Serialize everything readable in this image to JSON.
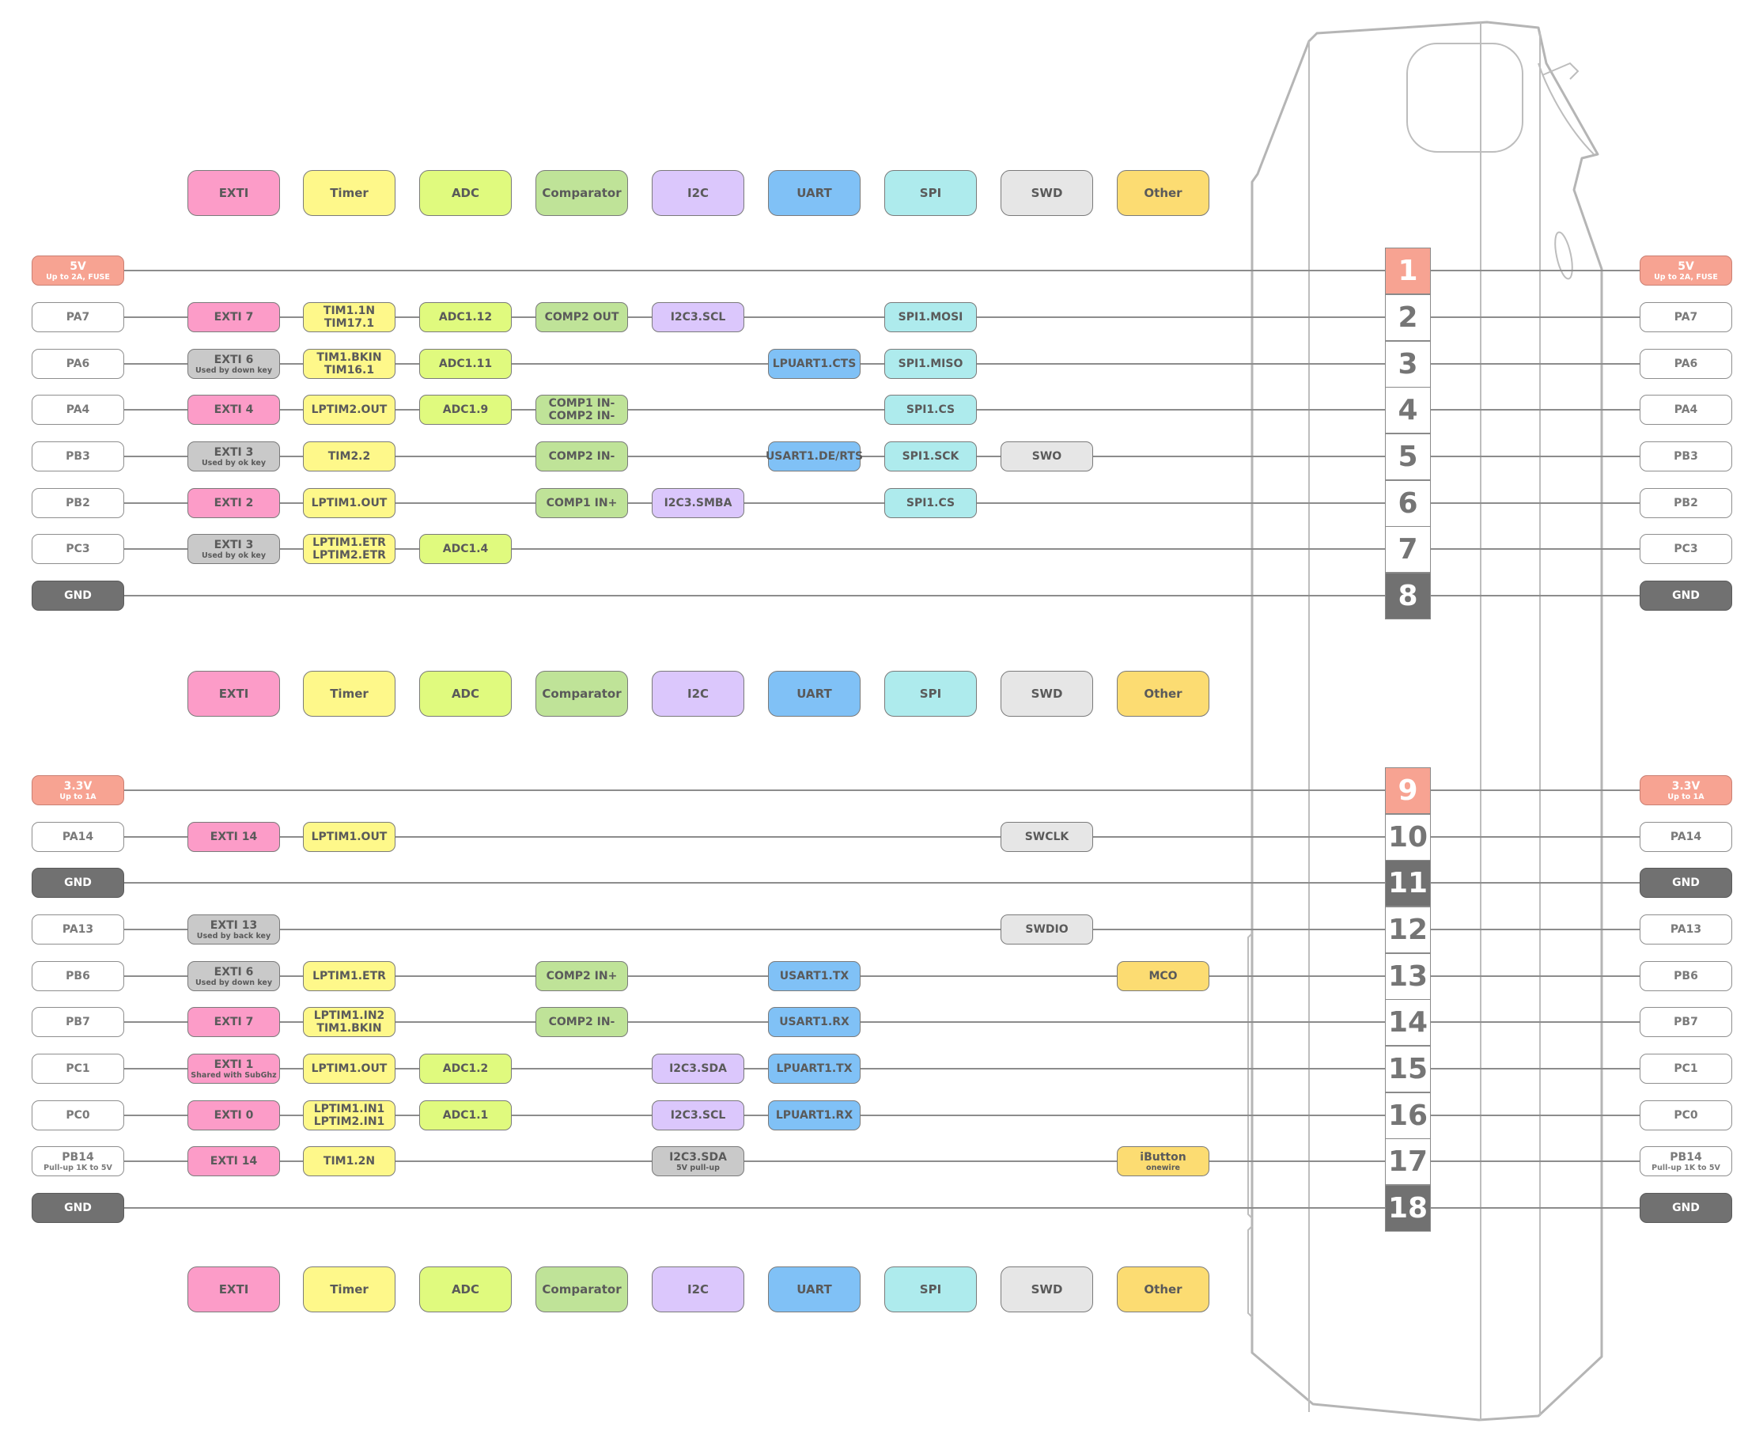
{
  "legend": [
    {
      "key": "exti",
      "label": "EXTI",
      "color": "#fc9cc8"
    },
    {
      "key": "timer",
      "label": "Timer",
      "color": "#fef88a"
    },
    {
      "key": "adc",
      "label": "ADC",
      "color": "#e0fa7e"
    },
    {
      "key": "comp",
      "label": "Comparator",
      "color": "#bfe398"
    },
    {
      "key": "i2c",
      "label": "I2C",
      "color": "#dbc7fc"
    },
    {
      "key": "uart",
      "label": "UART",
      "color": "#80c1f6"
    },
    {
      "key": "spi",
      "label": "SPI",
      "color": "#aeebed"
    },
    {
      "key": "swd",
      "label": "SWD",
      "color": "#e6e6e6"
    },
    {
      "key": "other",
      "label": "Other",
      "color": "#fcdc72"
    }
  ],
  "status_colors": {
    "power": "#f7a392",
    "ground": "#717171",
    "used_by_system": "#c9c9c9",
    "pin": "#ffffff"
  },
  "pins": [
    {
      "number": "1",
      "type": "power",
      "name": "5V",
      "note": "Up to 2A, FUSE",
      "functions": {}
    },
    {
      "number": "2",
      "type": "pin",
      "name": "PA7",
      "note": "",
      "functions": {
        "exti": {
          "label": "EXTI 7"
        },
        "timer": {
          "label": "TIM1.1N",
          "label2": "TIM17.1"
        },
        "adc": {
          "label": "ADC1.12"
        },
        "comp": {
          "label": "COMP2 OUT"
        },
        "i2c": {
          "label": "I2C3.SCL"
        },
        "spi": {
          "label": "SPI1.MOSI"
        }
      }
    },
    {
      "number": "3",
      "type": "pin",
      "name": "PA6",
      "note": "",
      "functions": {
        "exti": {
          "label": "EXTI 6",
          "note": "Used by down key",
          "used": true
        },
        "timer": {
          "label": "TIM1.BKIN",
          "label2": "TIM16.1"
        },
        "adc": {
          "label": "ADC1.11"
        },
        "uart": {
          "label": "LPUART1.CTS"
        },
        "spi": {
          "label": "SPI1.MISO"
        }
      }
    },
    {
      "number": "4",
      "type": "pin",
      "name": "PA4",
      "note": "",
      "functions": {
        "exti": {
          "label": "EXTI 4"
        },
        "timer": {
          "label": "LPTIM2.OUT"
        },
        "adc": {
          "label": "ADC1.9"
        },
        "comp": {
          "label": "COMP1 IN-",
          "label2": "COMP2 IN-"
        },
        "spi": {
          "label": "SPI1.CS"
        }
      }
    },
    {
      "number": "5",
      "type": "pin",
      "name": "PB3",
      "note": "",
      "functions": {
        "exti": {
          "label": "EXTI 3",
          "note": "Used by ok key",
          "used": true
        },
        "timer": {
          "label": "TIM2.2"
        },
        "comp": {
          "label": "COMP2 IN-"
        },
        "uart": {
          "label": "USART1.DE/RTS"
        },
        "spi": {
          "label": "SPI1.SCK"
        },
        "swd": {
          "label": "SWO"
        }
      }
    },
    {
      "number": "6",
      "type": "pin",
      "name": "PB2",
      "note": "",
      "functions": {
        "exti": {
          "label": "EXTI 2"
        },
        "timer": {
          "label": "LPTIM1.OUT"
        },
        "comp": {
          "label": "COMP1 IN+"
        },
        "i2c": {
          "label": "I2C3.SMBA"
        },
        "spi": {
          "label": "SPI1.CS"
        }
      }
    },
    {
      "number": "7",
      "type": "pin",
      "name": "PC3",
      "note": "",
      "functions": {
        "exti": {
          "label": "EXTI 3",
          "note": "Used by ok key",
          "used": true
        },
        "timer": {
          "label": "LPTIM1.ETR",
          "label2": "LPTIM2.ETR"
        },
        "adc": {
          "label": "ADC1.4"
        }
      }
    },
    {
      "number": "8",
      "type": "gnd",
      "name": "GND",
      "note": "",
      "functions": {}
    },
    {
      "number": "9",
      "type": "power",
      "name": "3.3V",
      "note": "Up to 1A",
      "functions": {}
    },
    {
      "number": "10",
      "type": "pin",
      "name": "PA14",
      "note": "",
      "functions": {
        "exti": {
          "label": "EXTI 14"
        },
        "timer": {
          "label": "LPTIM1.OUT"
        },
        "swd": {
          "label": "SWCLK"
        }
      }
    },
    {
      "number": "11",
      "type": "gnd",
      "name": "GND",
      "note": "",
      "functions": {}
    },
    {
      "number": "12",
      "type": "pin",
      "name": "PA13",
      "note": "",
      "functions": {
        "exti": {
          "label": "EXTI 13",
          "note": "Used by back key",
          "used": true
        },
        "swd": {
          "label": "SWDIO"
        }
      }
    },
    {
      "number": "13",
      "type": "pin",
      "name": "PB6",
      "note": "",
      "functions": {
        "exti": {
          "label": "EXTI 6",
          "note": "Used by down key",
          "used": true
        },
        "timer": {
          "label": "LPTIM1.ETR"
        },
        "comp": {
          "label": "COMP2 IN+"
        },
        "uart": {
          "label": "USART1.TX"
        },
        "other": {
          "label": "MCO"
        }
      }
    },
    {
      "number": "14",
      "type": "pin",
      "name": "PB7",
      "note": "",
      "functions": {
        "exti": {
          "label": "EXTI 7"
        },
        "timer": {
          "label": "LPTIM1.IN2",
          "label2": "TIM1.BKIN"
        },
        "comp": {
          "label": "COMP2 IN-"
        },
        "uart": {
          "label": "USART1.RX"
        }
      }
    },
    {
      "number": "15",
      "type": "pin",
      "name": "PC1",
      "note": "",
      "functions": {
        "exti": {
          "label": "EXTI 1",
          "note": "Shared with SubGhz"
        },
        "timer": {
          "label": "LPTIM1.OUT"
        },
        "adc": {
          "label": "ADC1.2"
        },
        "i2c": {
          "label": "I2C3.SDA"
        },
        "uart": {
          "label": "LPUART1.TX"
        }
      }
    },
    {
      "number": "16",
      "type": "pin",
      "name": "PC0",
      "note": "",
      "functions": {
        "exti": {
          "label": "EXTI 0"
        },
        "timer": {
          "label": "LPTIM1.IN1",
          "label2": "LPTIM2.IN1"
        },
        "adc": {
          "label": "ADC1.1"
        },
        "i2c": {
          "label": "I2C3.SCL"
        },
        "uart": {
          "label": "LPUART1.RX"
        }
      }
    },
    {
      "number": "17",
      "type": "pin",
      "name": "PB14",
      "note": "Pull-up 1K to 5V",
      "functions": {
        "exti": {
          "label": "EXTI 14"
        },
        "timer": {
          "label": "TIM1.2N"
        },
        "i2c": {
          "label": "I2C3.SDA",
          "note": "5V pull-up",
          "used": true
        },
        "other": {
          "label": "iButton",
          "note": "onewire"
        }
      }
    },
    {
      "number": "18",
      "type": "gnd",
      "name": "GND",
      "note": "",
      "functions": {}
    }
  ]
}
